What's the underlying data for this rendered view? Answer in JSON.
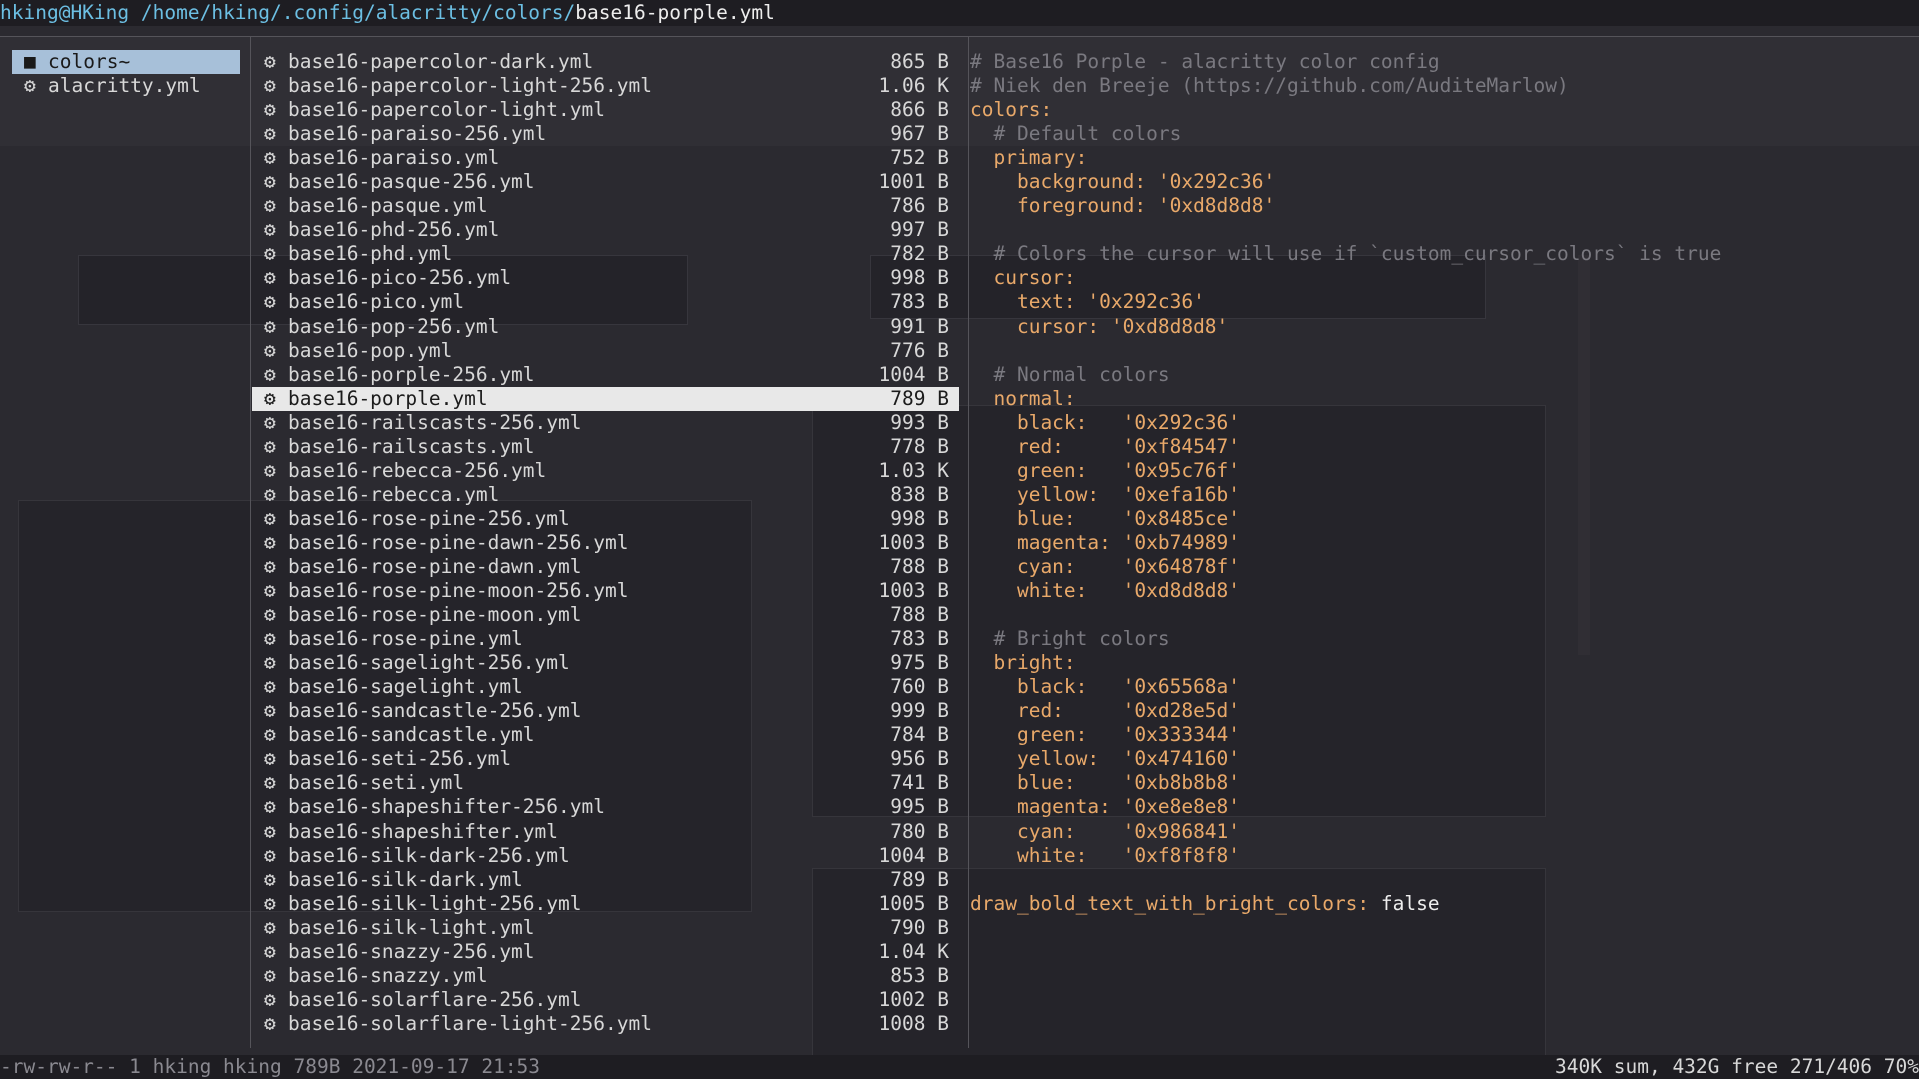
{
  "title": {
    "user": "hking@HKing",
    "dir": "/home/hking/.config/alacritty/colors/",
    "file": "base16-porple.yml"
  },
  "parent": [
    {
      "icon": "folder-icon",
      "name": "colors~",
      "selected": true
    },
    {
      "icon": "gear-icon",
      "name": "alacritty.yml",
      "selected": false
    }
  ],
  "files": [
    {
      "name": "base16-papercolor-dark.yml",
      "size": "865 B"
    },
    {
      "name": "base16-papercolor-light-256.yml",
      "size": "1.06 K"
    },
    {
      "name": "base16-papercolor-light.yml",
      "size": "866 B"
    },
    {
      "name": "base16-paraiso-256.yml",
      "size": "967 B"
    },
    {
      "name": "base16-paraiso.yml",
      "size": "752 B"
    },
    {
      "name": "base16-pasque-256.yml",
      "size": "1001 B"
    },
    {
      "name": "base16-pasque.yml",
      "size": "786 B"
    },
    {
      "name": "base16-phd-256.yml",
      "size": "997 B"
    },
    {
      "name": "base16-phd.yml",
      "size": "782 B"
    },
    {
      "name": "base16-pico-256.yml",
      "size": "998 B"
    },
    {
      "name": "base16-pico.yml",
      "size": "783 B"
    },
    {
      "name": "base16-pop-256.yml",
      "size": "991 B"
    },
    {
      "name": "base16-pop.yml",
      "size": "776 B"
    },
    {
      "name": "base16-porple-256.yml",
      "size": "1004 B"
    },
    {
      "name": "base16-porple.yml",
      "size": "789 B",
      "selected": true
    },
    {
      "name": "base16-railscasts-256.yml",
      "size": "993 B"
    },
    {
      "name": "base16-railscasts.yml",
      "size": "778 B"
    },
    {
      "name": "base16-rebecca-256.yml",
      "size": "1.03 K"
    },
    {
      "name": "base16-rebecca.yml",
      "size": "838 B"
    },
    {
      "name": "base16-rose-pine-256.yml",
      "size": "998 B"
    },
    {
      "name": "base16-rose-pine-dawn-256.yml",
      "size": "1003 B"
    },
    {
      "name": "base16-rose-pine-dawn.yml",
      "size": "788 B"
    },
    {
      "name": "base16-rose-pine-moon-256.yml",
      "size": "1003 B"
    },
    {
      "name": "base16-rose-pine-moon.yml",
      "size": "788 B"
    },
    {
      "name": "base16-rose-pine.yml",
      "size": "783 B"
    },
    {
      "name": "base16-sagelight-256.yml",
      "size": "975 B"
    },
    {
      "name": "base16-sagelight.yml",
      "size": "760 B"
    },
    {
      "name": "base16-sandcastle-256.yml",
      "size": "999 B"
    },
    {
      "name": "base16-sandcastle.yml",
      "size": "784 B"
    },
    {
      "name": "base16-seti-256.yml",
      "size": "956 B"
    },
    {
      "name": "base16-seti.yml",
      "size": "741 B"
    },
    {
      "name": "base16-shapeshifter-256.yml",
      "size": "995 B"
    },
    {
      "name": "base16-shapeshifter.yml",
      "size": "780 B"
    },
    {
      "name": "base16-silk-dark-256.yml",
      "size": "1004 B"
    },
    {
      "name": "base16-silk-dark.yml",
      "size": "789 B"
    },
    {
      "name": "base16-silk-light-256.yml",
      "size": "1005 B"
    },
    {
      "name": "base16-silk-light.yml",
      "size": "790 B"
    },
    {
      "name": "base16-snazzy-256.yml",
      "size": "1.04 K"
    },
    {
      "name": "base16-snazzy.yml",
      "size": "853 B"
    },
    {
      "name": "base16-solarflare-256.yml",
      "size": "1002 B"
    },
    {
      "name": "base16-solarflare-light-256.yml",
      "size": "1008 B"
    }
  ],
  "preview": [
    {
      "parts": [
        {
          "t": "# Base16 Porple - alacritty color config",
          "c": "com"
        }
      ]
    },
    {
      "parts": [
        {
          "t": "# Niek den Breeje (https://github.com/AuditeMarlow)",
          "c": "com"
        }
      ]
    },
    {
      "parts": [
        {
          "t": "colors:",
          "c": "key"
        }
      ]
    },
    {
      "parts": [
        {
          "t": "  # Default colors",
          "c": "com"
        }
      ]
    },
    {
      "parts": [
        {
          "t": "  primary:",
          "c": "key"
        }
      ]
    },
    {
      "parts": [
        {
          "t": "    background: ",
          "c": "key"
        },
        {
          "t": "'0x292c36'",
          "c": "str"
        }
      ]
    },
    {
      "parts": [
        {
          "t": "    foreground: ",
          "c": "key"
        },
        {
          "t": "'0xd8d8d8'",
          "c": "str"
        }
      ]
    },
    {
      "parts": []
    },
    {
      "parts": [
        {
          "t": "  # Colors the cursor will use if `custom_cursor_colors` is true",
          "c": "com"
        }
      ]
    },
    {
      "parts": [
        {
          "t": "  cursor:",
          "c": "key"
        }
      ]
    },
    {
      "parts": [
        {
          "t": "    text: ",
          "c": "key"
        },
        {
          "t": "'0x292c36'",
          "c": "str"
        }
      ]
    },
    {
      "parts": [
        {
          "t": "    cursor: ",
          "c": "key"
        },
        {
          "t": "'0xd8d8d8'",
          "c": "str"
        }
      ]
    },
    {
      "parts": []
    },
    {
      "parts": [
        {
          "t": "  # Normal colors",
          "c": "com"
        }
      ]
    },
    {
      "parts": [
        {
          "t": "  normal:",
          "c": "key"
        }
      ]
    },
    {
      "parts": [
        {
          "t": "    black:   ",
          "c": "key"
        },
        {
          "t": "'0x292c36'",
          "c": "str"
        }
      ]
    },
    {
      "parts": [
        {
          "t": "    red:     ",
          "c": "key"
        },
        {
          "t": "'0xf84547'",
          "c": "str"
        }
      ]
    },
    {
      "parts": [
        {
          "t": "    green:   ",
          "c": "key"
        },
        {
          "t": "'0x95c76f'",
          "c": "str"
        }
      ]
    },
    {
      "parts": [
        {
          "t": "    yellow:  ",
          "c": "key"
        },
        {
          "t": "'0xefa16b'",
          "c": "str"
        }
      ]
    },
    {
      "parts": [
        {
          "t": "    blue:    ",
          "c": "key"
        },
        {
          "t": "'0x8485ce'",
          "c": "str"
        }
      ]
    },
    {
      "parts": [
        {
          "t": "    magenta: ",
          "c": "key"
        },
        {
          "t": "'0xb74989'",
          "c": "str"
        }
      ]
    },
    {
      "parts": [
        {
          "t": "    cyan:    ",
          "c": "key"
        },
        {
          "t": "'0x64878f'",
          "c": "str"
        }
      ]
    },
    {
      "parts": [
        {
          "t": "    white:   ",
          "c": "key"
        },
        {
          "t": "'0xd8d8d8'",
          "c": "str"
        }
      ]
    },
    {
      "parts": []
    },
    {
      "parts": [
        {
          "t": "  # Bright colors",
          "c": "com"
        }
      ]
    },
    {
      "parts": [
        {
          "t": "  bright:",
          "c": "key"
        }
      ]
    },
    {
      "parts": [
        {
          "t": "    black:   ",
          "c": "key"
        },
        {
          "t": "'0x65568a'",
          "c": "str"
        }
      ]
    },
    {
      "parts": [
        {
          "t": "    red:     ",
          "c": "key"
        },
        {
          "t": "'0xd28e5d'",
          "c": "str"
        }
      ]
    },
    {
      "parts": [
        {
          "t": "    green:   ",
          "c": "key"
        },
        {
          "t": "'0x333344'",
          "c": "str"
        }
      ]
    },
    {
      "parts": [
        {
          "t": "    yellow:  ",
          "c": "key"
        },
        {
          "t": "'0x474160'",
          "c": "str"
        }
      ]
    },
    {
      "parts": [
        {
          "t": "    blue:    ",
          "c": "key"
        },
        {
          "t": "'0xb8b8b8'",
          "c": "str"
        }
      ]
    },
    {
      "parts": [
        {
          "t": "    magenta: ",
          "c": "key"
        },
        {
          "t": "'0xe8e8e8'",
          "c": "str"
        }
      ]
    },
    {
      "parts": [
        {
          "t": "    cyan:    ",
          "c": "key"
        },
        {
          "t": "'0x986841'",
          "c": "str"
        }
      ]
    },
    {
      "parts": [
        {
          "t": "    white:   ",
          "c": "key"
        },
        {
          "t": "'0xf8f8f8'",
          "c": "str"
        }
      ]
    },
    {
      "parts": []
    },
    {
      "parts": [
        {
          "t": "draw_bold_text_with_bright_colors: ",
          "c": "key"
        },
        {
          "t": "false",
          "c": "plain"
        }
      ]
    }
  ],
  "status": {
    "left": "-rw-rw-r-- 1 hking hking 789B 2021-09-17 21:53",
    "right": "340K sum, 432G free  271/406  70%"
  },
  "colors": {
    "dir": "#6cbfe3",
    "key": "#e9a96a",
    "comment": "#7a7980",
    "selection": "#e8e8e8",
    "parent_selection": "#a7c0d9"
  }
}
